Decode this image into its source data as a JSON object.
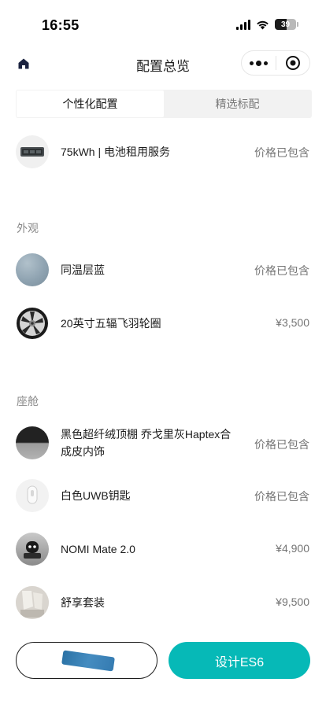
{
  "status": {
    "time": "16:55",
    "battery": "39"
  },
  "nav": {
    "title": "配置总览"
  },
  "tabs": [
    {
      "label": "个性化配置",
      "active": true
    },
    {
      "label": "精选标配",
      "active": false
    }
  ],
  "battery_item": {
    "label": "75kWh | 电池租用服务",
    "price": "价格已包含"
  },
  "exterior": {
    "title": "外观",
    "items": [
      {
        "label": "同温层蓝",
        "price": "价格已包含"
      },
      {
        "label": "20英寸五辐飞羽轮圈",
        "price": "¥3,500"
      }
    ]
  },
  "cabin": {
    "title": "座舱",
    "items": [
      {
        "label_line1": "黑色超纤绒顶棚 乔戈里灰Haptex合",
        "label_line2": "成皮内饰",
        "price": "价格已包含"
      },
      {
        "label": "白色UWB钥匙",
        "price": "价格已包含"
      },
      {
        "label": "NOMI Mate 2.0",
        "price": "¥4,900"
      },
      {
        "label": "舒享套装",
        "price": "¥9,500"
      }
    ]
  },
  "buttons": {
    "left_label": "",
    "right_label": "设计ES6"
  },
  "colors": {
    "accent": "#06b9b7",
    "paint_swatch": "#8fa3b1"
  }
}
